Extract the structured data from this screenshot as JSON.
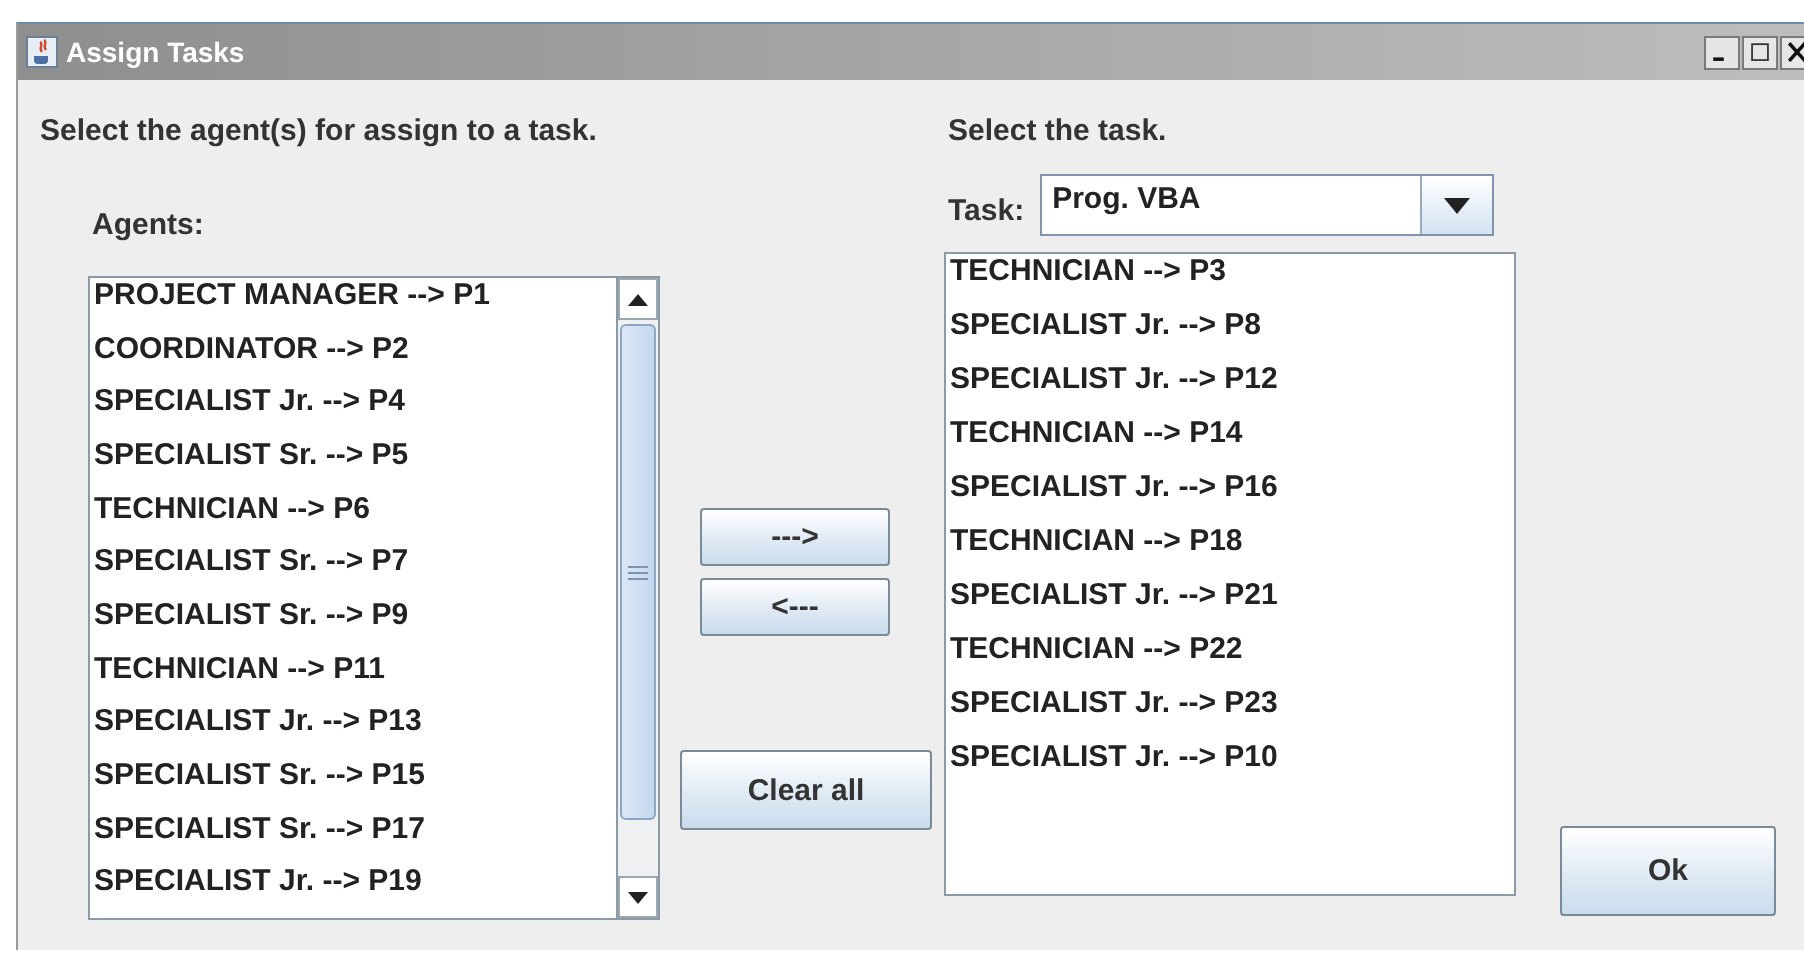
{
  "window": {
    "title": "Assign Tasks"
  },
  "agents_panel": {
    "heading": "Select the agent(s) for assign to a task.",
    "list_label": "Agents:",
    "items": [
      "PROJECT MANAGER --> P1",
      "COORDINATOR --> P2",
      "SPECIALIST Jr. --> P4",
      "SPECIALIST Sr. --> P5",
      "TECHNICIAN --> P6",
      "SPECIALIST Sr. --> P7",
      "SPECIALIST Sr. --> P9",
      "TECHNICIAN --> P11",
      "SPECIALIST Jr. --> P13",
      "SPECIALIST Sr. --> P15",
      "SPECIALIST Sr. --> P17",
      "SPECIALIST Jr. --> P19"
    ]
  },
  "move_buttons": [
    {
      "label": "--->"
    },
    {
      "label": "<---"
    }
  ],
  "clear_button": {
    "label": "Clear all"
  },
  "task_panel": {
    "heading": "Select the task.",
    "task_label": "Task:",
    "task_value": "Prog. VBA",
    "items": [
      "TECHNICIAN --> P3",
      "SPECIALIST Jr. --> P8",
      "SPECIALIST Jr. --> P12",
      "TECHNICIAN --> P14",
      "SPECIALIST Jr. --> P16",
      "TECHNICIAN --> P18",
      "SPECIALIST Jr. --> P21",
      "TECHNICIAN --> P22",
      "SPECIALIST Jr. --> P23",
      "SPECIALIST Jr. --> P10"
    ]
  },
  "ok_button": {
    "label": "Ok"
  }
}
